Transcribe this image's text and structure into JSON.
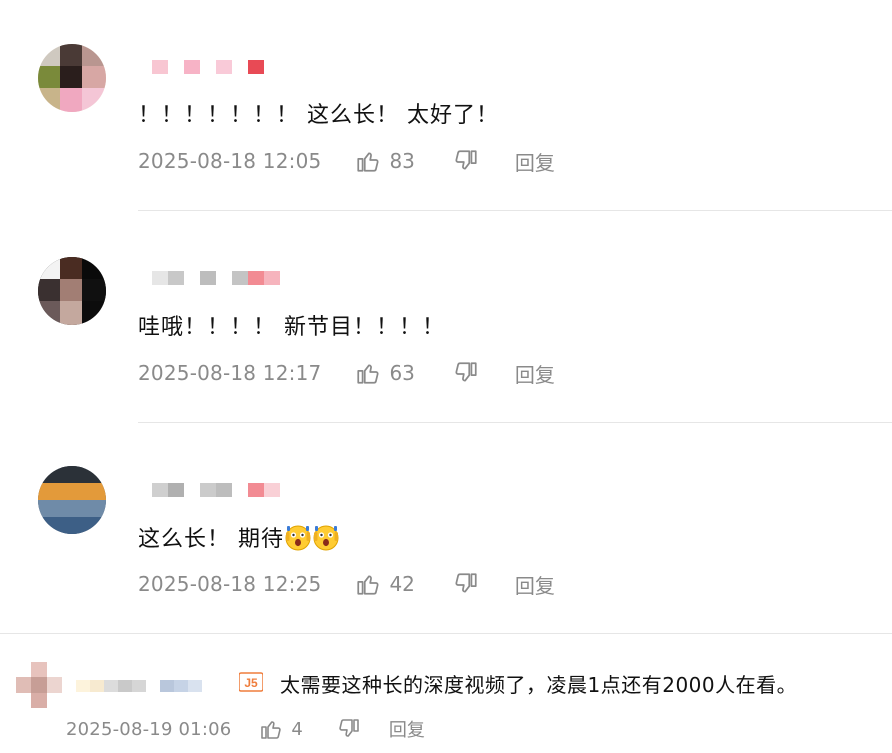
{
  "comments": [
    {
      "text": "！！！！！！！ 这么长！ 太好了！",
      "time": "2025-08-18 12:05",
      "likes": "83",
      "reply_label": "回复",
      "name_pixel_colors": [
        "#f8c6d2",
        "#ffffff",
        "#f7b3c6",
        "#ffffff",
        "#f9cad8",
        "#ffffff",
        "#e84a55"
      ]
    },
    {
      "text": "哇哦！！！！ 新节目！！！！",
      "time": "2025-08-18 12:17",
      "likes": "63",
      "reply_label": "回复",
      "name_pixel_colors": [
        "#e6e6e6",
        "#c8c8c8",
        "#ffffff",
        "#bdbdbd",
        "#ffffff",
        "#c4c4c4",
        "#f28b93",
        "#f6b4bd"
      ]
    },
    {
      "text": "这么长！ 期待",
      "time": "2025-08-18 12:25",
      "likes": "42",
      "reply_label": "回复",
      "name_pixel_colors": [
        "#cfcfcf",
        "#b0b0b0",
        "#ffffff",
        "#cbcbcb",
        "#bdbdbd",
        "#ffffff",
        "#f28b93",
        "#f9d0d6"
      ]
    },
    {
      "text": "太需要这种长的深度视频了，凌晨1点还有2000人在看。",
      "time": "2025-08-19 01:06",
      "likes": "4",
      "reply_label": "回复",
      "name_pixel_colors": [
        "#fdf3dc",
        "#f7ead0",
        "#dcdcdc",
        "#c9c9c9",
        "#d6d6d6",
        "#ffffff",
        "#b9c7dc",
        "#c6d3e6",
        "#d9e2ef"
      ]
    }
  ],
  "icons": {
    "like": "thumbs-up-icon",
    "dislike": "thumbs-down-icon",
    "emoji": "shocked-emoji-icon",
    "badge": "level-badge-icon"
  }
}
